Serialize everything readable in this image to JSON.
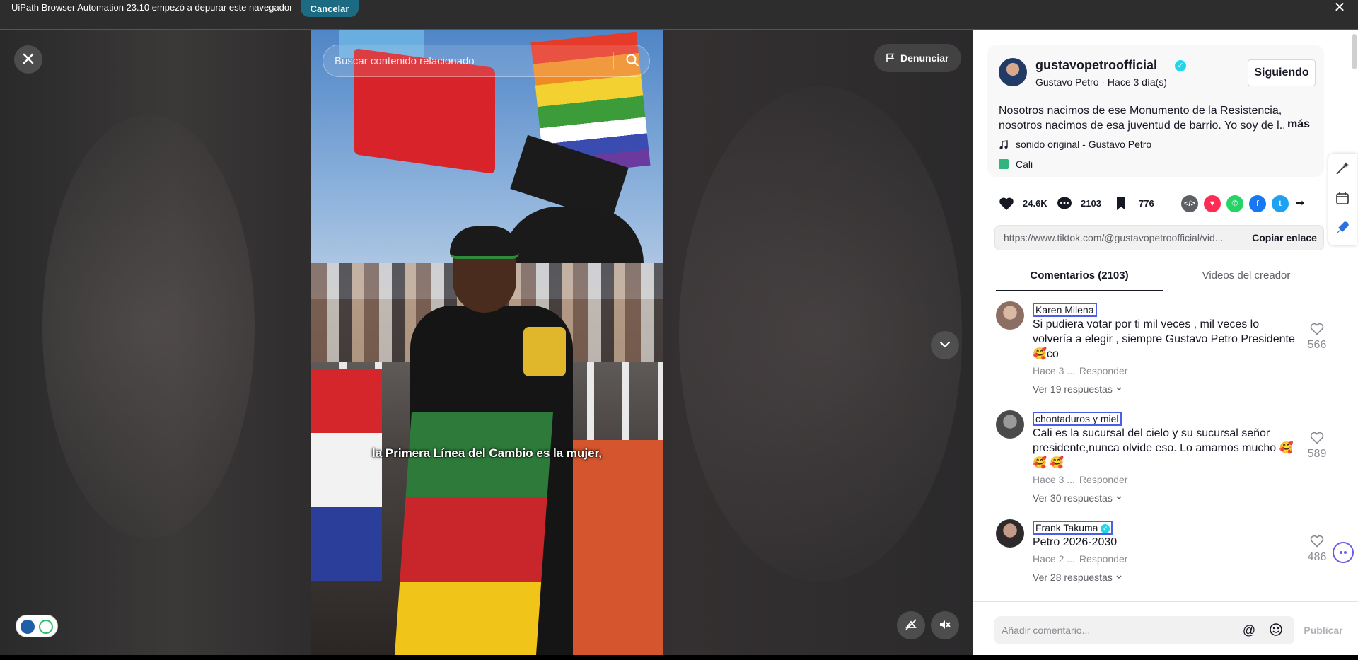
{
  "banner": {
    "text": "UiPath Browser Automation 23.10 empezó a depurar este navegador",
    "cancel_label": "Cancelar",
    "close_glyph": "✕"
  },
  "video": {
    "search_placeholder": "Buscar contenido relacionado",
    "report_label": "Denunciar",
    "subtitle": "la Primera Línea del Cambio es la mujer,"
  },
  "post": {
    "username": "gustavopetroofficial",
    "subline": "Gustavo Petro · Hace 3 día(s)",
    "following_label": "Siguiendo",
    "description_line1": "Nosotros nacimos de ese Monumento de la Resistencia,",
    "description_line2": "nosotros nacimos de esa juventud de barrio. Yo soy de l...",
    "more_label": "más",
    "sound": "sonido original - Gustavo Petro",
    "location": "Cali"
  },
  "actions": {
    "likes": "24.6K",
    "comments": "2103",
    "saves": "776",
    "share_icons": [
      "embed-icon",
      "tiktok-friends-icon",
      "whatsapp-icon",
      "facebook-icon",
      "twitter-icon",
      "share-arrow-icon"
    ]
  },
  "link": {
    "url": "https://www.tiktok.com/@gustavopetroofficial/vid...",
    "copy_label": "Copiar enlace"
  },
  "tabs": {
    "comments_label": "Comentarios (2103)",
    "creator_videos_label": "Videos del creador"
  },
  "comments": [
    {
      "name": "Karen Milena",
      "verified": false,
      "text": "Si pudiera votar por ti mil veces , mil veces lo volvería a elegir , siempre Gustavo Petro Presidente 🥰co",
      "time": "Hace 3 ...",
      "reply_label": "Responder",
      "likes": "566",
      "replies_label": "Ver 19 respuestas"
    },
    {
      "name": "chontaduros y miel",
      "verified": false,
      "text": "Cali es la sucursal del cielo y su sucursal señor presidente,nunca olvide eso. Lo amamos mucho 🥰 🥰 🥰",
      "time": "Hace 3 ...",
      "reply_label": "Responder",
      "likes": "589",
      "replies_label": "Ver 30 respuestas"
    },
    {
      "name": "Frank Takuma",
      "verified": true,
      "text": "Petro 2026-2030",
      "time": "Hace 2 ...",
      "reply_label": "Responder",
      "likes": "486",
      "replies_label": "Ver 28 respuestas"
    }
  ],
  "comment_box": {
    "placeholder": "Añadir comentario...",
    "mention_glyph": "@",
    "publish_label": "Publicar"
  },
  "colors": {
    "banner_bg": "#2d2d2d",
    "cancel_bg": "#1d6b83",
    "verified": "#20d5ec",
    "highlight_border": "#4a5ee8"
  }
}
